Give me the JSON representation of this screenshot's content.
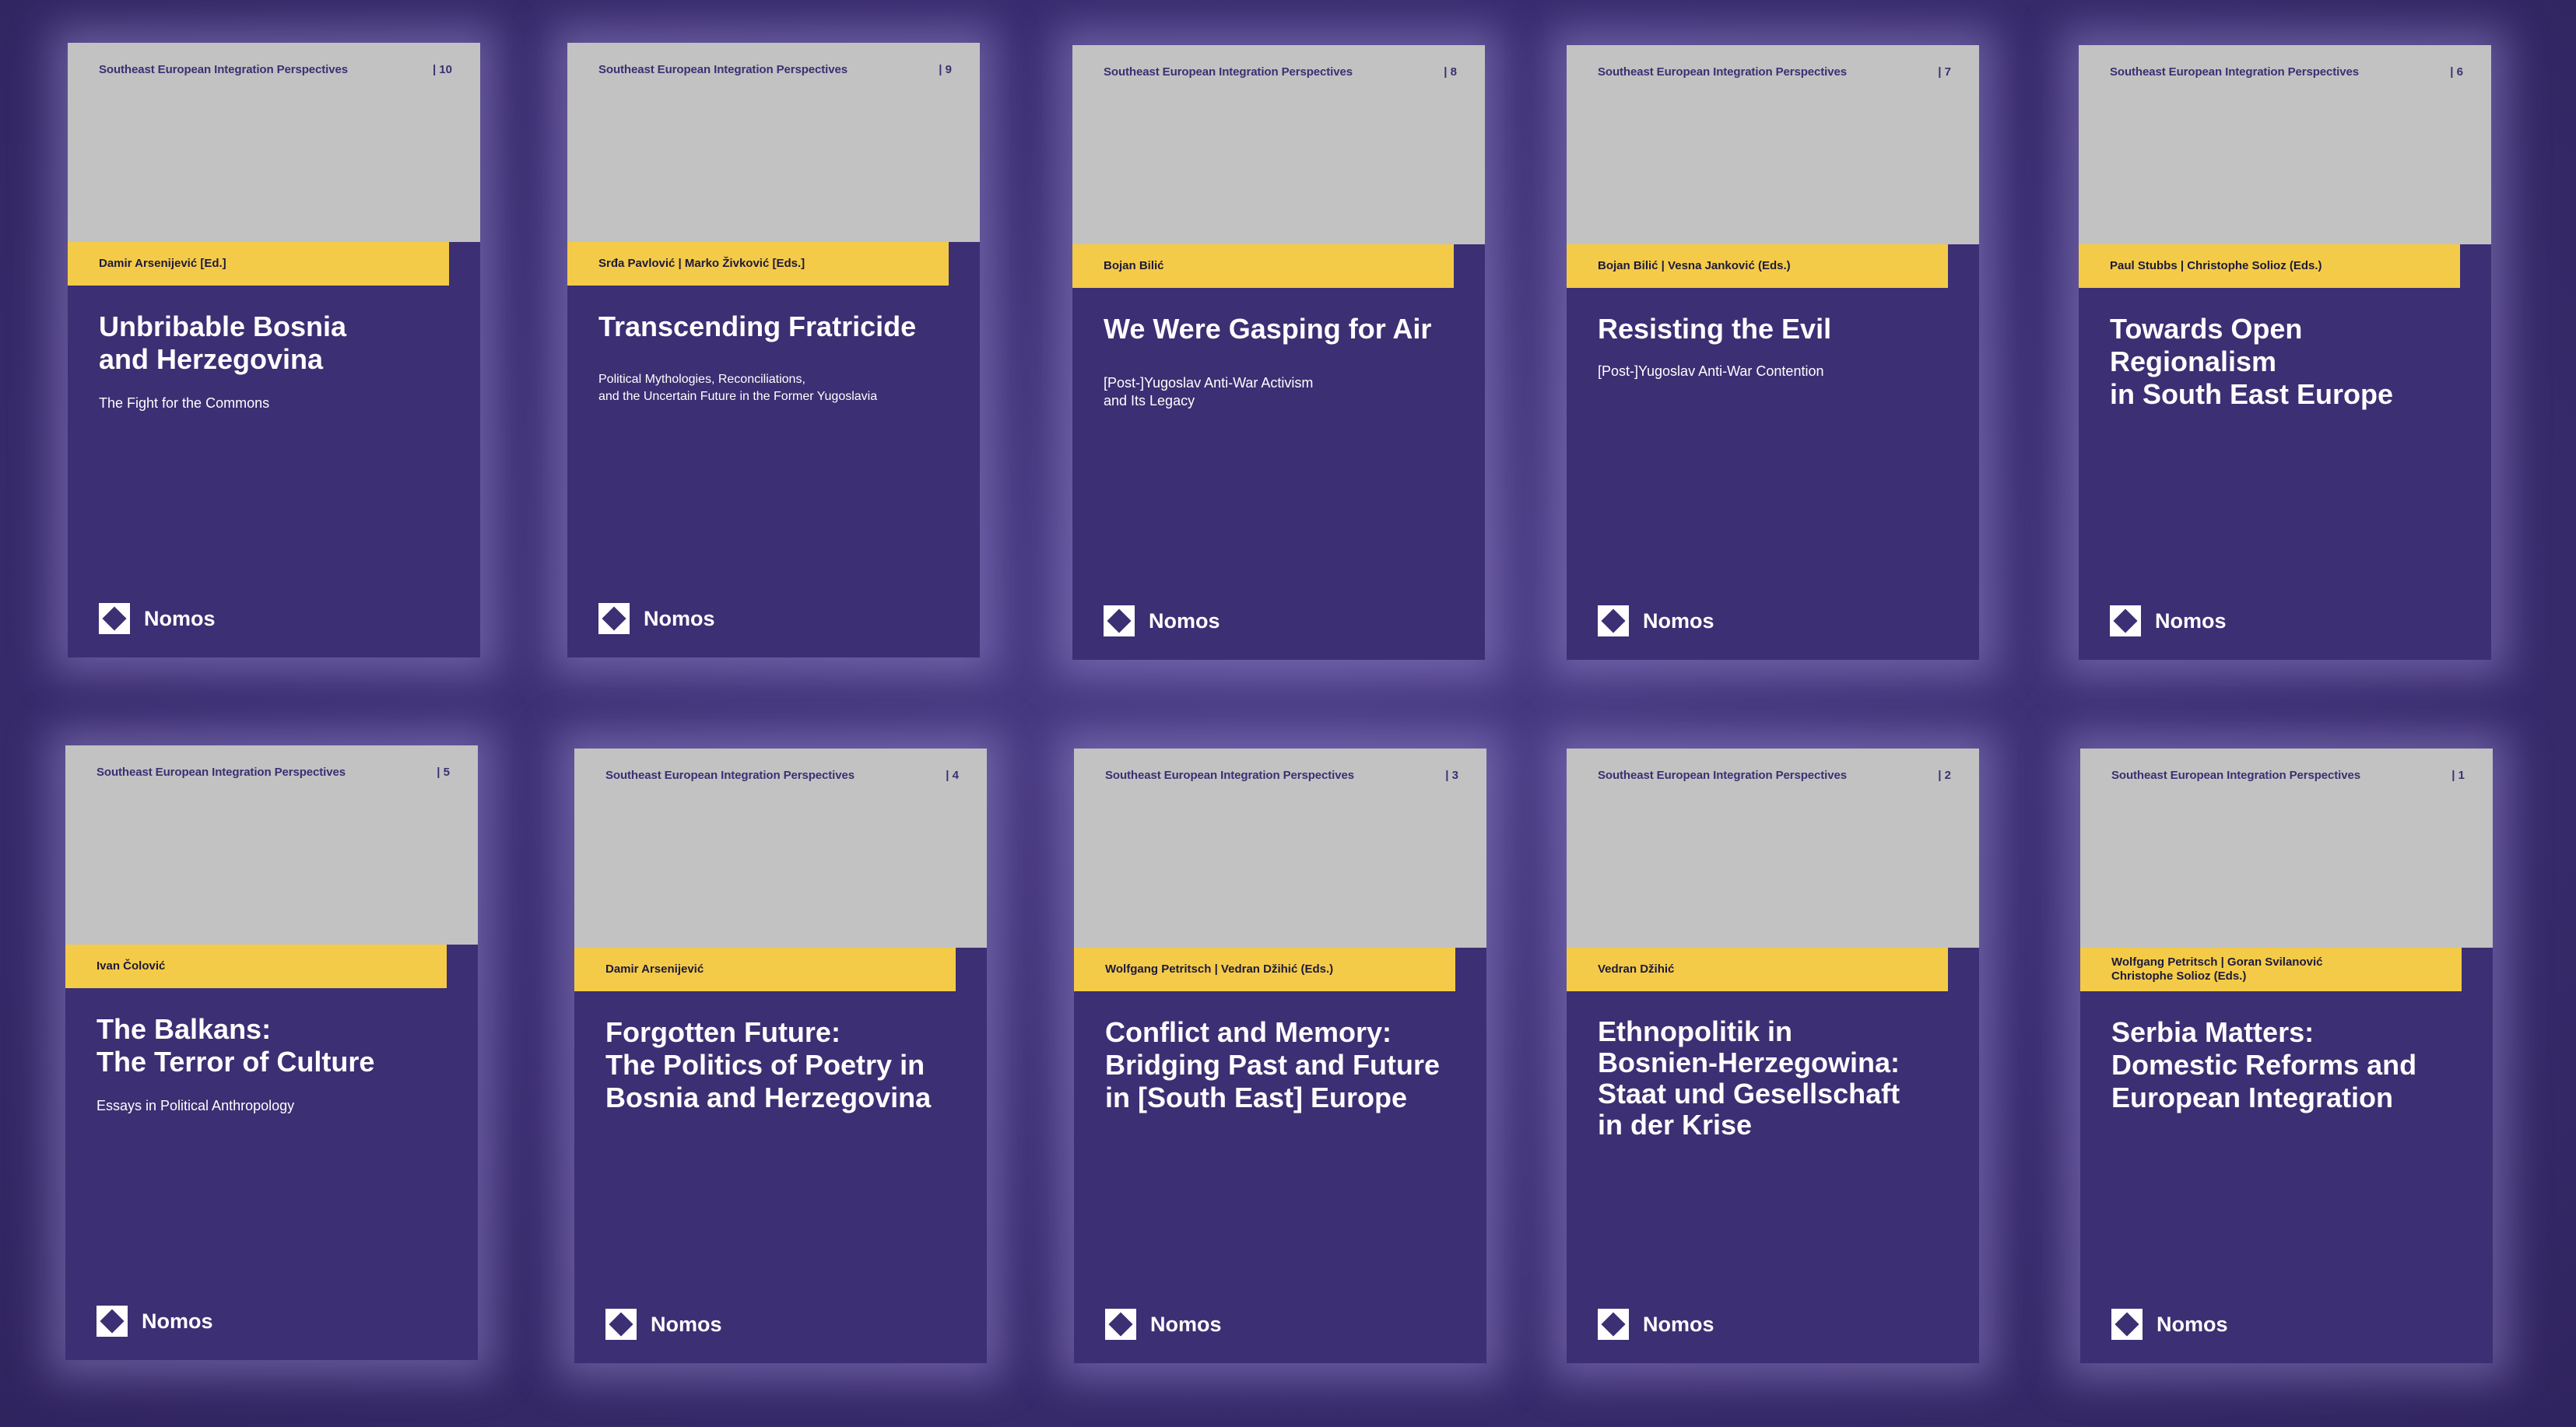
{
  "series_name": "Southeast European Integration Perspectives",
  "publisher": "Nomos",
  "colors": {
    "cover_body": "#3c2f73",
    "cover_top": "#c2c2c2",
    "author_band": "#f4cb48",
    "title_text": "#ffffff"
  },
  "books": [
    {
      "volume": "| 10",
      "editors": "Damir Arsenijević [Ed.]",
      "title": "Unbribable Bosnia\nand Herzegovina",
      "subtitle": "The Fight for the Commons"
    },
    {
      "volume": "| 9",
      "editors": "Srđa Pavlović | Marko Živković [Eds.]",
      "title": "Transcending Fratricide",
      "subtitle": "Political Mythologies, Reconciliations,\nand the Uncertain Future in the Former Yugoslavia"
    },
    {
      "volume": "| 8",
      "editors": "Bojan Bilić",
      "title": "We Were Gasping for Air",
      "subtitle": "[Post-]Yugoslav Anti-War Activism\nand Its Legacy"
    },
    {
      "volume": "| 7",
      "editors": "Bojan Bilić | Vesna Janković (Eds.)",
      "title": "Resisting the Evil",
      "subtitle": "[Post-]Yugoslav Anti-War Contention"
    },
    {
      "volume": "| 6",
      "editors": "Paul Stubbs | Christophe Solioz (Eds.)",
      "title": "Towards Open Regionalism\nin South East Europe",
      "subtitle": ""
    },
    {
      "volume": "| 5",
      "editors": "Ivan Čolović",
      "title": "The Balkans:\nThe Terror of Culture",
      "subtitle": "Essays in Political Anthropology"
    },
    {
      "volume": "| 4",
      "editors": "Damir Arsenijević",
      "title": "Forgotten Future:\nThe Politics of Poetry in\nBosnia and Herzegovina",
      "subtitle": ""
    },
    {
      "volume": "| 3",
      "editors": "Wolfgang Petritsch | Vedran Džihić (Eds.)",
      "title": "Conflict and Memory:\nBridging Past and Future\nin [South East] Europe",
      "subtitle": ""
    },
    {
      "volume": "| 2",
      "editors": "Vedran Džihić",
      "title": "Ethnopolitik in\nBosnien-Herzegowina:\nStaat und Gesellschaft\nin der Krise",
      "subtitle": ""
    },
    {
      "volume": "| 1",
      "editors": "Wolfgang Petritsch | Goran Svilanović\nChristophe Solioz (Eds.)",
      "title": "Serbia Matters:\nDomestic Reforms and\nEuropean Integration",
      "subtitle": ""
    }
  ]
}
